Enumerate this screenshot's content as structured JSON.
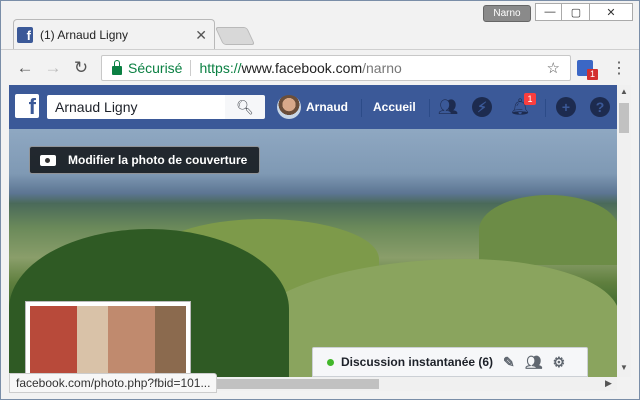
{
  "browser": {
    "tab_title": "(1) Arnaud Ligny",
    "tab_close": "✕",
    "profile_name": "Narno",
    "window_min": "—",
    "window_max": "▢",
    "window_close": "✕",
    "secure_label": "Sécurisé",
    "url_scheme": "https://",
    "url_host": "www.facebook.com",
    "url_path": "/narno",
    "extension_badge": "1",
    "status_url": "facebook.com/photo.php?fbid=101..."
  },
  "facebook": {
    "logo": "f",
    "search_value": "Arnaud Ligny",
    "user_name": "Arnaud",
    "home_label": "Accueil",
    "notifications_count": "1",
    "cover_button_label": "Modifier la photo de couverture",
    "chat_label": "Discussion instantanée (6)"
  },
  "icons": {
    "back": "arrow-left-icon",
    "forward": "arrow-right-icon",
    "reload": "reload-icon",
    "star": "bookmark-star-icon",
    "friends": "friends-icon",
    "messenger": "messenger-icon",
    "notifications": "bell-icon",
    "create": "plus-icon",
    "help": "help-icon"
  },
  "colors": {
    "facebook_blue": "#3b5998",
    "secure_green": "#0b8043",
    "badge_red": "#fa3e3e",
    "online_green": "#42b72a"
  }
}
